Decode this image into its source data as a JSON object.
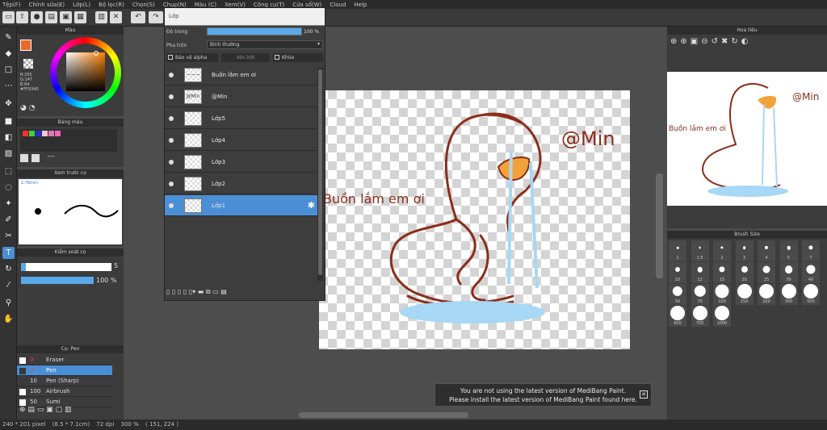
{
  "menu": [
    "Tệp(F)",
    "Chỉnh sửa(E)",
    "Lớp(L)",
    "Bộ lọc(R)",
    "Chọn(S)",
    "Chụp(N)",
    "Màu (C)",
    "Xem(V)",
    "Công cụ(T)",
    "Cửa sổ(W)",
    "Cloud",
    "Help"
  ],
  "color_panel": {
    "title": "Màu",
    "fg_color": "#e86a28",
    "r": "R:255",
    "g": "G:147",
    "b": "B:64",
    "hex": "#FF9340"
  },
  "palette_panel": {
    "title": "Bảng màu",
    "swatches": [
      "#ff2d2d",
      "#3cd43c",
      "#2b2bd9",
      "#f3c6d6",
      "#d97ab0",
      "#eb6ab8"
    ],
    "dashes": "---"
  },
  "preview_panel": {
    "title": "Xem trước cọ",
    "size": "1.76mm"
  },
  "brush_control_panel": {
    "title": "Kiểm soát cọ",
    "size_value": "5",
    "opacity_value": "100 %",
    "opacity_fraction": 1.0,
    "size_fraction": 0.05
  },
  "brush_list_panel": {
    "title": "Cọ: Pen",
    "items": [
      {
        "size": "3",
        "name": "Eraser",
        "color": "#ffffff"
      },
      {
        "size": "3",
        "name": "Pen",
        "color": "#3a3a3a"
      },
      {
        "size": "10",
        "name": "Pen (Sharp)",
        "color": "#3a3a3a"
      },
      {
        "size": "100",
        "name": "Airbrush",
        "color": "#ffffff"
      },
      {
        "size": "50",
        "name": "Sumi",
        "color": "#ffffff"
      }
    ]
  },
  "layers_panel": {
    "title": "Lớp",
    "opacity_label": "Độ trong",
    "opacity_value": "100 %",
    "opacity_fraction": 1.0,
    "blend_label": "Pha trộn",
    "blend_value": "Bình thường",
    "protect_alpha": "Bảo vệ alpha",
    "clipping": "Xén bớt",
    "lock": "Khóa",
    "layers": [
      {
        "name": "Buồn lắm em ơi",
        "thumb": "———"
      },
      {
        "name": "@Min",
        "thumb": "@Min"
      },
      {
        "name": "Lớp5",
        "thumb": ""
      },
      {
        "name": "Lớp4",
        "thumb": ""
      },
      {
        "name": "Lớp3",
        "thumb": ""
      },
      {
        "name": "Lớp2",
        "thumb": ""
      },
      {
        "name": "Lớp1",
        "thumb": ""
      }
    ]
  },
  "artwork": {
    "text_main": "Buồn lắm em ơi",
    "text_handle": "@Min",
    "line_color": "#8b2d1a",
    "beak_color": "#f2a23a",
    "tear_color": "#a7d8f5"
  },
  "navigator_panel": {
    "title": "Hoa tiêu"
  },
  "brush_size_panel": {
    "title": "Brush Size",
    "sizes": [
      "1",
      "1.5",
      "2",
      "3",
      "4",
      "5",
      "7",
      "10",
      "12",
      "15",
      "20",
      "25",
      "30",
      "40",
      "50",
      "70",
      "100",
      "150",
      "200",
      "300",
      "500",
      "600",
      "700",
      "1000"
    ]
  },
  "notification": {
    "line1": "You are not using the latest version of MediBang Paint.",
    "line2": "Please install the latest version of MediBang Paint found here."
  },
  "status": {
    "dimensions": "240 * 201 pixel",
    "physical": "(8.5 * 7.1cm)",
    "dpi": "72 dpi",
    "zoom": "300 %",
    "coords": "( 151, 224 )"
  }
}
